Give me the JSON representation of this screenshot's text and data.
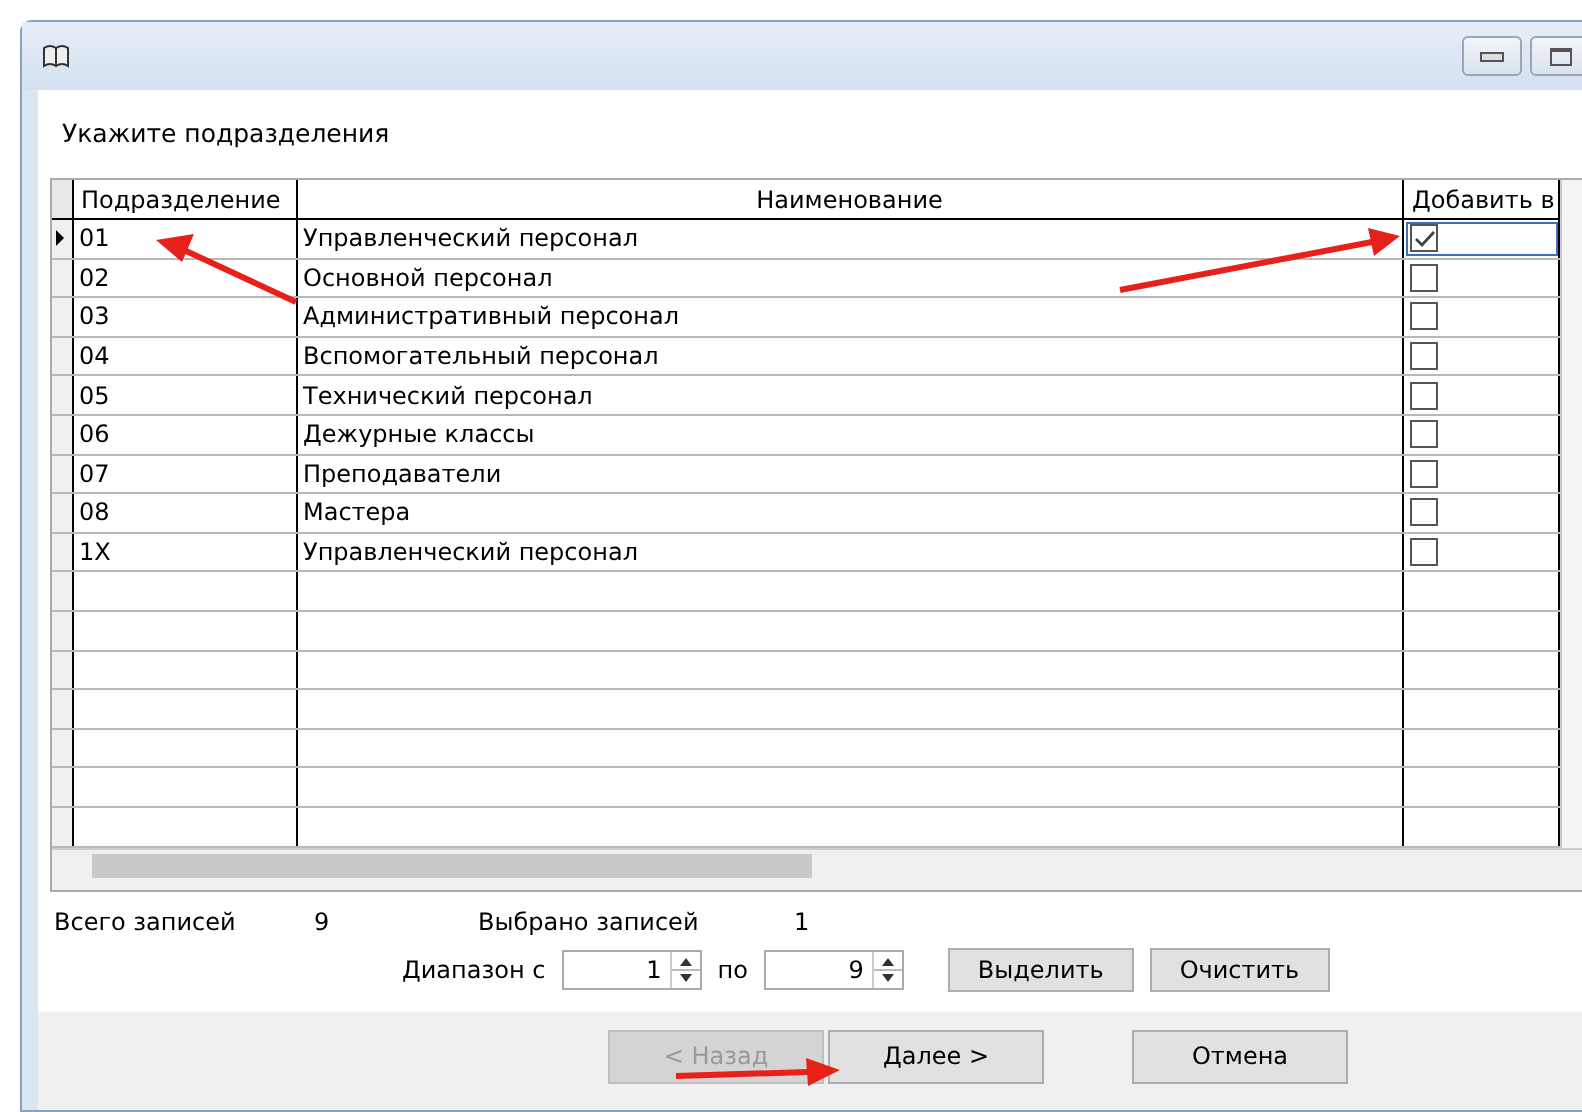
{
  "dialog": {
    "prompt": "Укажите подразделения"
  },
  "table": {
    "columns": [
      "Подразделение",
      "Наименование",
      "Добавить в"
    ],
    "rows": [
      {
        "code": "01",
        "name": "Управленческий персонал",
        "checked": true,
        "selected": true
      },
      {
        "code": "02",
        "name": "Основной персонал",
        "checked": false,
        "selected": false
      },
      {
        "code": "03",
        "name": "Административный персонал",
        "checked": false,
        "selected": false
      },
      {
        "code": "04",
        "name": "Вспомогательный персонал",
        "checked": false,
        "selected": false
      },
      {
        "code": "05",
        "name": "Технический персонал",
        "checked": false,
        "selected": false
      },
      {
        "code": "06",
        "name": "Дежурные классы",
        "checked": false,
        "selected": false
      },
      {
        "code": "07",
        "name": "Преподаватели",
        "checked": false,
        "selected": false
      },
      {
        "code": "08",
        "name": "Мастера",
        "checked": false,
        "selected": false
      },
      {
        "code": "1X",
        "name": "Управленческий персонал",
        "checked": false,
        "selected": false
      }
    ]
  },
  "summary": {
    "total_label": "Всего записей",
    "total": "9",
    "selected_label": "Выбрано записей",
    "selected_count": "1"
  },
  "range": {
    "from_label": "Диапазон с",
    "from": "1",
    "to_label": "по",
    "to": "9"
  },
  "range_buttons": [
    "Выделить",
    "Очистить"
  ],
  "nav_buttons": [
    {
      "label": "< Назад",
      "disabled": true
    },
    {
      "label": "Далее  >",
      "disabled": false
    },
    {
      "label": "Отмена",
      "disabled": false
    }
  ]
}
